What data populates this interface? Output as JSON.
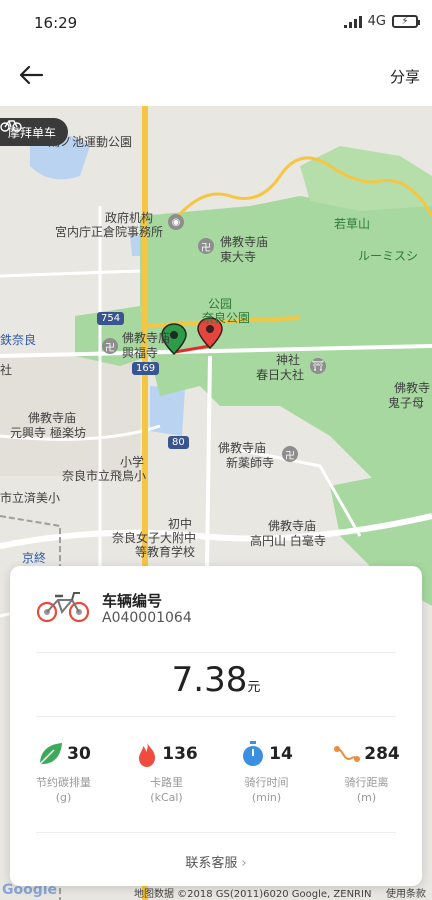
{
  "status_bar": {
    "time": "16:29",
    "network": "4G"
  },
  "header": {
    "share_label": "分享"
  },
  "map": {
    "brand_tag": "摩拜单车",
    "labels": {
      "park_sports": "鴻ノ池運動公園",
      "gov": "政府机构",
      "gov_office": "宮内庁正倉院事務所",
      "temple_todaiji_type": "佛教寺庙",
      "temple_todaiji": "東大寺",
      "wakakusa": "若草山",
      "rumisshi": "ルーミスシ",
      "park": "公园",
      "nara_park": "奈良公園",
      "temple_kofukuji_type": "佛教寺庙",
      "temple_kofukuji": "興福寺",
      "shrine_type": "神社",
      "kasuga": "春日大社",
      "temple_right_type": "佛教寺",
      "temple_right_name": "鬼子母",
      "station_nara": "鉄奈良",
      "shrine_left": "社",
      "temple_gangoji_type": "佛教寺庙",
      "temple_gangoji": "元興寺",
      "gokurakubo": "極楽坊",
      "temple_shin_type": "佛教寺庙",
      "temple_shin": "新薬師寺",
      "elem_school": "小学",
      "elem_school_name": "奈良市立飛鳥小",
      "city_school": "市立済美小",
      "middle": "初中",
      "middle_name1": "奈良女子大附中",
      "middle_name2": "等教育学校",
      "temple_byakugo_type": "佛教寺庙",
      "temple_byakugo": "高円山 白毫寺",
      "kyobate": "京終",
      "route_754": "754",
      "route_169": "169",
      "route_80": "80"
    },
    "attribution": "地图数据 ©2018 GS(2011)6020 Google, ZENRIN",
    "terms": "使用条款",
    "google_logo": "Google"
  },
  "trip": {
    "title": "车辆编号",
    "bike_number": "A040001064",
    "fare_value": "7.38",
    "fare_unit": "元",
    "stats": [
      {
        "value": "30",
        "label": "节约碳排量",
        "unit": "(g)",
        "icon": "leaf-icon",
        "color": "#3daa5a"
      },
      {
        "value": "136",
        "label": "卡路里",
        "unit": "(kCal)",
        "icon": "flame-icon",
        "color": "#ef4b3f"
      },
      {
        "value": "14",
        "label": "骑行时间",
        "unit": "(min)",
        "icon": "stopwatch-icon",
        "color": "#3b8fe3"
      },
      {
        "value": "284",
        "label": "骑行距离",
        "unit": "(m)",
        "icon": "route-icon",
        "color": "#f08a3c"
      }
    ],
    "contact_label": "联系客服"
  },
  "colors": {
    "map_green": "#a7d8a0",
    "route_red": "#e32b2b",
    "road_yellow": "#f5c642",
    "start_pin": "#2e9b4a",
    "end_pin": "#e6453f"
  }
}
